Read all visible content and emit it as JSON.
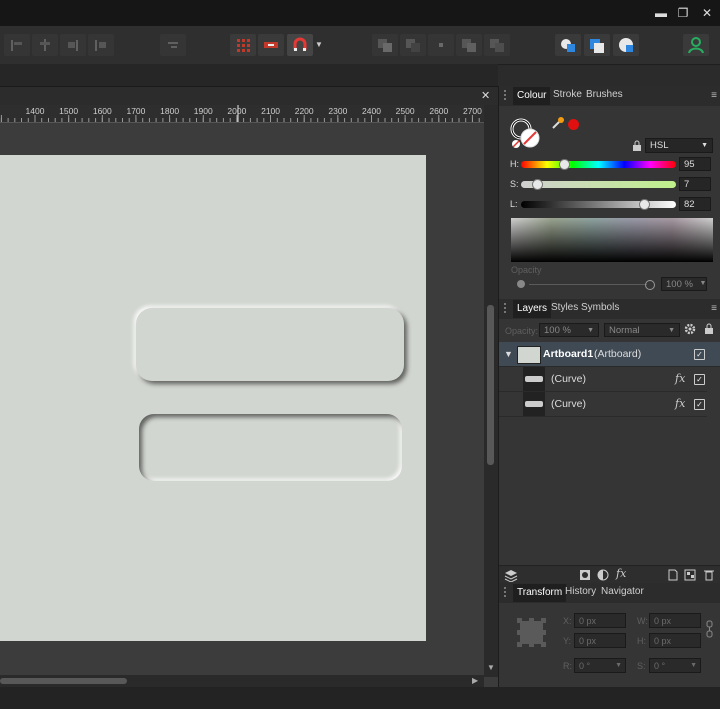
{
  "window": {
    "minimize_glyph": "▬",
    "restore_glyph": "❐",
    "close_glyph": "✕"
  },
  "doc": {
    "close_glyph": "✕"
  },
  "ruler": {
    "labels": [
      "1400",
      "1500",
      "1600",
      "1700",
      "1800",
      "1900",
      "2000",
      "2100",
      "2200",
      "2300",
      "2400",
      "2500",
      "2600",
      "2700"
    ]
  },
  "colour_panel": {
    "tabs": [
      "Colour",
      "Stroke",
      "Brushes"
    ],
    "menu_glyph": "≡",
    "model": "HSL",
    "h_label": "H:",
    "h_value": "95",
    "s_label": "S:",
    "s_value": "7",
    "l_label": "L:",
    "l_value": "82",
    "opacity_label": "Opacity",
    "opacity_value": "100 %",
    "fill_color": "#d2d6d0",
    "accent": "#e01010"
  },
  "layers_panel": {
    "tabs": [
      "Layers",
      "Styles",
      "Symbols"
    ],
    "menu_glyph": "≡",
    "opacity_label": "Opacity:",
    "opacity_value": "100 %",
    "blend_mode": "Normal",
    "layers": [
      {
        "name": "Artboard1",
        "type": "(Artboard)",
        "checked": "✓"
      },
      {
        "name": "(Curve)",
        "fx": "fx",
        "checked": "✓"
      },
      {
        "name": "(Curve)",
        "fx": "fx",
        "checked": "✓"
      }
    ],
    "footer_fx": "fx"
  },
  "transform_panel": {
    "tabs": [
      "Transform",
      "History",
      "Navigator"
    ],
    "x_label": "X:",
    "x_value": "0 px",
    "y_label": "Y:",
    "y_value": "0 px",
    "w_label": "W:",
    "w_value": "0 px",
    "h_label": "H:",
    "h_value": "0 px",
    "r_label": "R:",
    "r_value": "0 °",
    "s_label": "S:",
    "s_value": "0 °"
  }
}
